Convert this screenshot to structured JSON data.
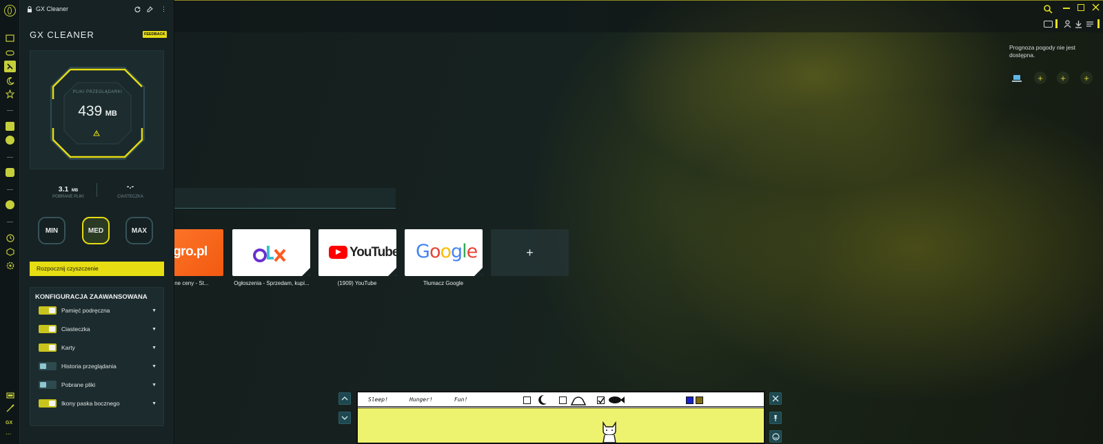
{
  "app": {
    "panel_window_title": "GX Cleaner",
    "panel_heading": "GX CLEANER",
    "feedback_label": "FEEDBACK"
  },
  "cleaner": {
    "gauge_caption": "PLIKI PRZEGLĄDARKI",
    "gauge_value": "439",
    "gauge_unit": "MB",
    "downloads_value": "3.1",
    "downloads_unit": "MB",
    "downloads_caption": "POBRANE PLIKI",
    "cookies_value": "-.-",
    "cookies_caption": "CIASTECZKA",
    "modes": [
      "MIN",
      "MED",
      "MAX"
    ],
    "selected_mode": "MED",
    "start_button": "Rozpocznij czyszczenie"
  },
  "config": {
    "title": "KONFIGURACJA ZAAWANSOWANA",
    "items": [
      {
        "label": "Pamięć podręczna",
        "enabled": true
      },
      {
        "label": "Ciasteczka",
        "enabled": true
      },
      {
        "label": "Karty",
        "enabled": true
      },
      {
        "label": "Historia przeglądania",
        "enabled": false
      },
      {
        "label": "Pobrane pliki",
        "enabled": false
      },
      {
        "label": "Ikony paska bocznego",
        "enabled": true
      }
    ]
  },
  "sidebar": {
    "bottom_label": "GX",
    "more_label": "..."
  },
  "speed_dial": [
    {
      "name": "allegro",
      "tile_text": "egro.pl",
      "label": "akcyjne ceny - St..."
    },
    {
      "name": "olx",
      "tile_text": "OLX",
      "label": "Ogłoszenia - Sprzedam, kupi..."
    },
    {
      "name": "youtube",
      "tile_text": "YouTube",
      "label": "(1909) YouTube"
    },
    {
      "name": "google",
      "tile_text": "Google",
      "label": "Tłumacz Google"
    }
  ],
  "add_tile_symbol": "+",
  "weather": {
    "message": "Prognoza pogody nie jest dostępna."
  },
  "pet_widget": {
    "stats": [
      "Sleep!",
      "Hunger!",
      "Fun!"
    ]
  },
  "colors": {
    "accent": "#e6dd13",
    "panel_bg": "#172224",
    "toggle_on": "#c9c41d",
    "toggle_off": "#2d4a4f",
    "widget_bg": "#eef36f"
  }
}
